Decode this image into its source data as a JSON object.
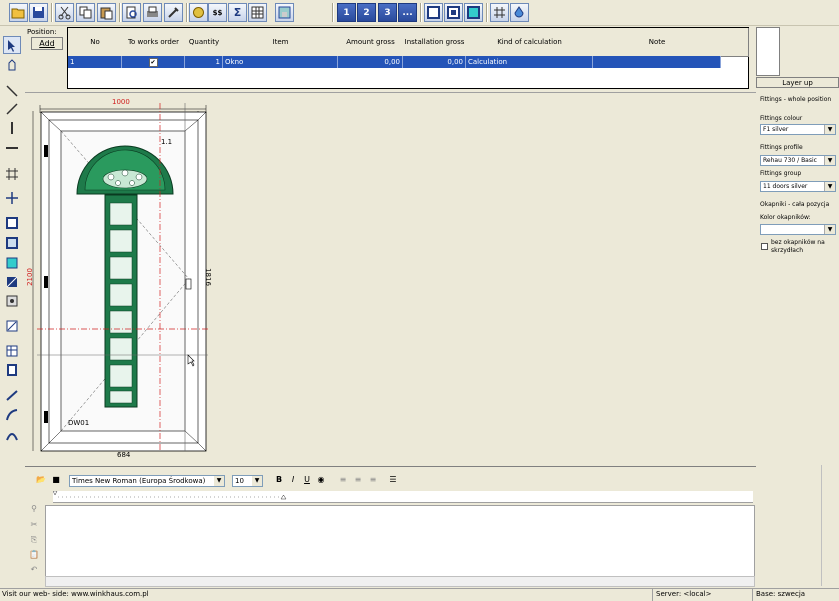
{
  "toolbar": {
    "number_buttons": [
      "1",
      "2",
      "3",
      "..."
    ],
    "sum_label": "Σ",
    "money_label": "$$"
  },
  "position": {
    "label": "Position:",
    "add_label": "Add"
  },
  "grid": {
    "headers": [
      "No",
      "To works order",
      "Quantity",
      "Item",
      "Amount gross",
      "Installation gross",
      "Kind of calculation",
      "Note"
    ],
    "row": {
      "no": "1",
      "works_order": "✔",
      "quantity": "1",
      "item": "Okno",
      "amount": "0,00",
      "installation": "0,00",
      "kind": "Calculation",
      "note": ""
    }
  },
  "layer_up_label": "Layer up",
  "fittings": {
    "title": "Fittings - whole position",
    "colour_label": "Fittings colour",
    "colour_value": "F1 silver",
    "profile_label": "Fittings profile",
    "profile_value": "Rehau 730 / Basic",
    "group_label": "Fittings group",
    "group_value": "11 doors silver",
    "okapniki_title": "Okapniki - cała pozycja",
    "kolor_label": "Kolor okapników:",
    "kolor_value": "",
    "checkbox_label": "bez okapników na skrzydłach"
  },
  "drawing": {
    "width_top": "1000",
    "width_bottom": "684",
    "height_left": "2100",
    "height_right": "1816",
    "sash_label": "1.1",
    "element_label": "DW01",
    "colors": {
      "frame": "#ffffff",
      "glass_green": "#1e7a4a",
      "dim_red": "#d02020"
    }
  },
  "editor": {
    "font_name": "Times New Roman (Europa Środkowa)",
    "font_size": "10",
    "bold": "B",
    "italic": "I",
    "underline": "U"
  },
  "status": {
    "website": "Visit our web- side: www.winkhaus.com.pl",
    "server": "Server: <local>",
    "base": "Base: szwecja"
  }
}
